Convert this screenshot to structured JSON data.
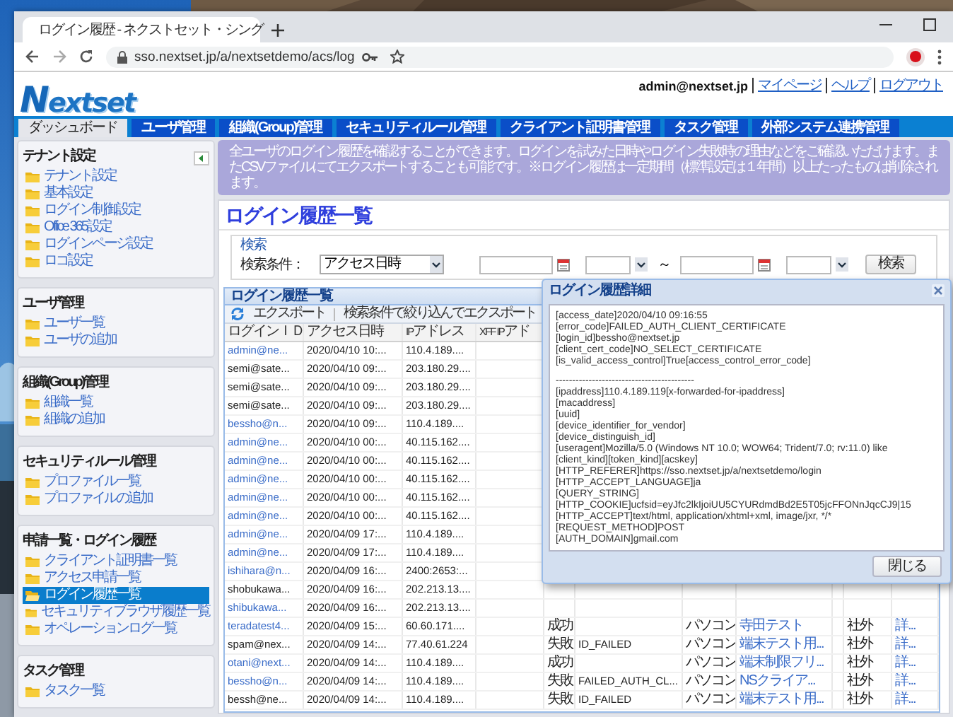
{
  "browser": {
    "tab_title": "ログイン履歴 - ネクストセット・シング",
    "url": "sso.nextset.jp/a/nextsetdemo/acs/log"
  },
  "header": {
    "logo": "Nextset",
    "user": "admin@nextset.jp",
    "links": [
      "マイページ",
      "ヘルプ",
      "ログアウト"
    ]
  },
  "nav": [
    {
      "label": "ダッシュボード",
      "selected": true
    },
    {
      "label": "ユーザ管理",
      "selected": false
    },
    {
      "label": "組織(Group)管理",
      "selected": false
    },
    {
      "label": "セキュリティルール管理",
      "selected": false
    },
    {
      "label": "クライアント証明書管理",
      "selected": false
    },
    {
      "label": "タスク管理",
      "selected": false
    },
    {
      "label": "外部システム連携管理",
      "selected": false
    }
  ],
  "sidebar": [
    {
      "title": "テナント設定",
      "items": [
        {
          "label": "テナント設定",
          "selected": false
        },
        {
          "label": "基本設定",
          "selected": false
        },
        {
          "label": "ログイン制御設定",
          "selected": false
        },
        {
          "label": "Office 365設定",
          "selected": false
        },
        {
          "label": "ログインページ設定",
          "selected": false
        },
        {
          "label": "ロゴ設定",
          "selected": false
        }
      ]
    },
    {
      "title": "ユーザ管理",
      "items": [
        {
          "label": "ユーザ一覧",
          "selected": false
        },
        {
          "label": "ユーザの追加",
          "selected": false
        }
      ]
    },
    {
      "title": "組織(Group)管理",
      "items": [
        {
          "label": "組織一覧",
          "selected": false
        },
        {
          "label": "組織の追加",
          "selected": false
        }
      ]
    },
    {
      "title": "セキュリティルール管理",
      "items": [
        {
          "label": "プロファイル一覧",
          "selected": false
        },
        {
          "label": "プロファイルの追加",
          "selected": false
        }
      ]
    },
    {
      "title": "申請一覧・ログイン履歴",
      "items": [
        {
          "label": "クライアント証明書一覧",
          "selected": false
        },
        {
          "label": "アクセス申請一覧",
          "selected": false
        },
        {
          "label": "ログイン履歴一覧",
          "selected": true
        },
        {
          "label": "セキュリティブラウザ履歴一覧",
          "selected": false
        },
        {
          "label": "オペレーションログ一覧",
          "selected": false
        }
      ]
    },
    {
      "title": "タスク管理",
      "items": [
        {
          "label": "タスク一覧",
          "selected": false
        }
      ]
    }
  ],
  "notice": "全ユーザのログイン履歴を確認することができます。ログインを試みた日時やログイン失敗時の理由などをご確認いただけます。またCSVファイルにてエクスポートすることも可能です。※ログイン履歴は一定期間（標準設定は１年間）以上たったものは削除されます。",
  "page_title": "ログイン履歴一覧",
  "search": {
    "legend": "検索",
    "label": "検索条件：",
    "condition": "アクセス日時",
    "separator": "～",
    "button": "検索"
  },
  "grid": {
    "title": "ログイン履歴一覧",
    "toolbar": [
      "エクスポート",
      "検索条件で絞り込んでエクスポート"
    ],
    "columns": [
      "ログインＩＤ",
      "アクセス日時",
      "IPアドレス",
      "XFF IPアド"
    ],
    "rows": [
      {
        "login_id": "admin@ne...",
        "linked": true,
        "date": "2020/04/10 10:...",
        "ip": "110.4.189...."
      },
      {
        "login_id": "semi@sate...",
        "linked": false,
        "date": "2020/04/10 09:...",
        "ip": "203.180.29...."
      },
      {
        "login_id": "semi@sate...",
        "linked": false,
        "date": "2020/04/10 09:...",
        "ip": "203.180.29...."
      },
      {
        "login_id": "semi@sate...",
        "linked": false,
        "date": "2020/04/10 09:...",
        "ip": "203.180.29...."
      },
      {
        "login_id": "bessho@n...",
        "linked": true,
        "date": "2020/04/10 09:...",
        "ip": "110.4.189...."
      },
      {
        "login_id": "admin@ne...",
        "linked": true,
        "date": "2020/04/10 00:...",
        "ip": "40.115.162...."
      },
      {
        "login_id": "admin@ne...",
        "linked": true,
        "date": "2020/04/10 00:...",
        "ip": "40.115.162...."
      },
      {
        "login_id": "admin@ne...",
        "linked": true,
        "date": "2020/04/10 00:...",
        "ip": "40.115.162...."
      },
      {
        "login_id": "admin@ne...",
        "linked": true,
        "date": "2020/04/10 00:...",
        "ip": "40.115.162...."
      },
      {
        "login_id": "admin@ne...",
        "linked": true,
        "date": "2020/04/10 00:...",
        "ip": "40.115.162...."
      },
      {
        "login_id": "admin@ne...",
        "linked": true,
        "date": "2020/04/09 17:...",
        "ip": "110.4.189...."
      },
      {
        "login_id": "admin@ne...",
        "linked": true,
        "date": "2020/04/09 17:...",
        "ip": "110.4.189...."
      },
      {
        "login_id": "ishihara@n...",
        "linked": true,
        "date": "2020/04/09 16:...",
        "ip": "2400:2653:..."
      },
      {
        "login_id": "shobukawa...",
        "linked": false,
        "date": "2020/04/09 16:...",
        "ip": "202.213.13...."
      },
      {
        "login_id": "shibukawa...",
        "linked": true,
        "date": "2020/04/09 16:...",
        "ip": "202.213.13...."
      },
      {
        "login_id": "teradatest4...",
        "linked": true,
        "date": "2020/04/09 15:...",
        "ip": "60.60.171....",
        "result": "成功",
        "device": "パソコン",
        "profile": "寺田テスト",
        "location": "社外",
        "detail": "詳..."
      },
      {
        "login_id": "spam@nex...",
        "linked": false,
        "date": "2020/04/09 14:...",
        "ip": "77.40.61.224",
        "result": "失敗",
        "error": "ID_FAILED",
        "device": "パソコン",
        "profile": "端末テスト用...",
        "location": "社外",
        "detail": "詳..."
      },
      {
        "login_id": "otani@next...",
        "linked": true,
        "date": "2020/04/09 14:...",
        "ip": "110.4.189....",
        "result": "成功",
        "device": "パソコン",
        "profile": "端末制限フリ...",
        "location": "社外",
        "detail": "詳..."
      },
      {
        "login_id": "bessho@n...",
        "linked": true,
        "date": "2020/04/09 14:...",
        "ip": "110.4.189....",
        "result": "失敗",
        "error": "FAILED_AUTH_CL...",
        "device": "パソコン",
        "profile": "NSクライア...",
        "location": "社外",
        "detail": "詳..."
      },
      {
        "login_id": "bessh@ne...",
        "linked": false,
        "date": "2020/04/09 14:...",
        "ip": "110.4.189....",
        "result": "失敗",
        "error": "ID_FAILED",
        "device": "パソコン",
        "profile": "端末テスト用...",
        "location": "社外",
        "detail": "詳..."
      }
    ]
  },
  "dialog": {
    "title": "ログイン履歴詳細",
    "sections": [
      [
        "[access_date]2020/04/10 09:16:55",
        "[error_code]FAILED_AUTH_CLIENT_CERTIFICATE",
        "[login_id]bessho@nextset.jp",
        "[client_cert_code]NO_SELECT_CERTIFICATE",
        "[is_valid_access_control]True[access_control_error_code]"
      ],
      [
        "------------------------------------------",
        "[ipaddress]110.4.189.119[x-forwarded-for-ipaddress]",
        "[macaddress]",
        "[uuid]",
        "[device_identifier_for_vendor]",
        "[device_distinguish_id]",
        "[useragent]Mozilla/5.0 (Windows NT 10.0; WOW64; Trident/7.0; rv:11.0) like",
        "[client_kind][token_kind][acskey]",
        "[HTTP_REFERER]https://sso.nextset.jp/a/nextsetdemo/login",
        "[HTTP_ACCEPT_LANGUAGE]ja",
        "[QUERY_STRING]",
        "[HTTP_COOKIE]ucfsid=eyJfc2lkIjoiUU5CYURdmdBd2E5T05jcFFONnJqcCJ9|15",
        "[HTTP_ACCEPT]text/html, application/xhtml+xml, image/jxr, */*",
        "[REQUEST_METHOD]POST",
        "[AUTH_DOMAIN]gmail.com"
      ]
    ],
    "button": "閉じる"
  }
}
